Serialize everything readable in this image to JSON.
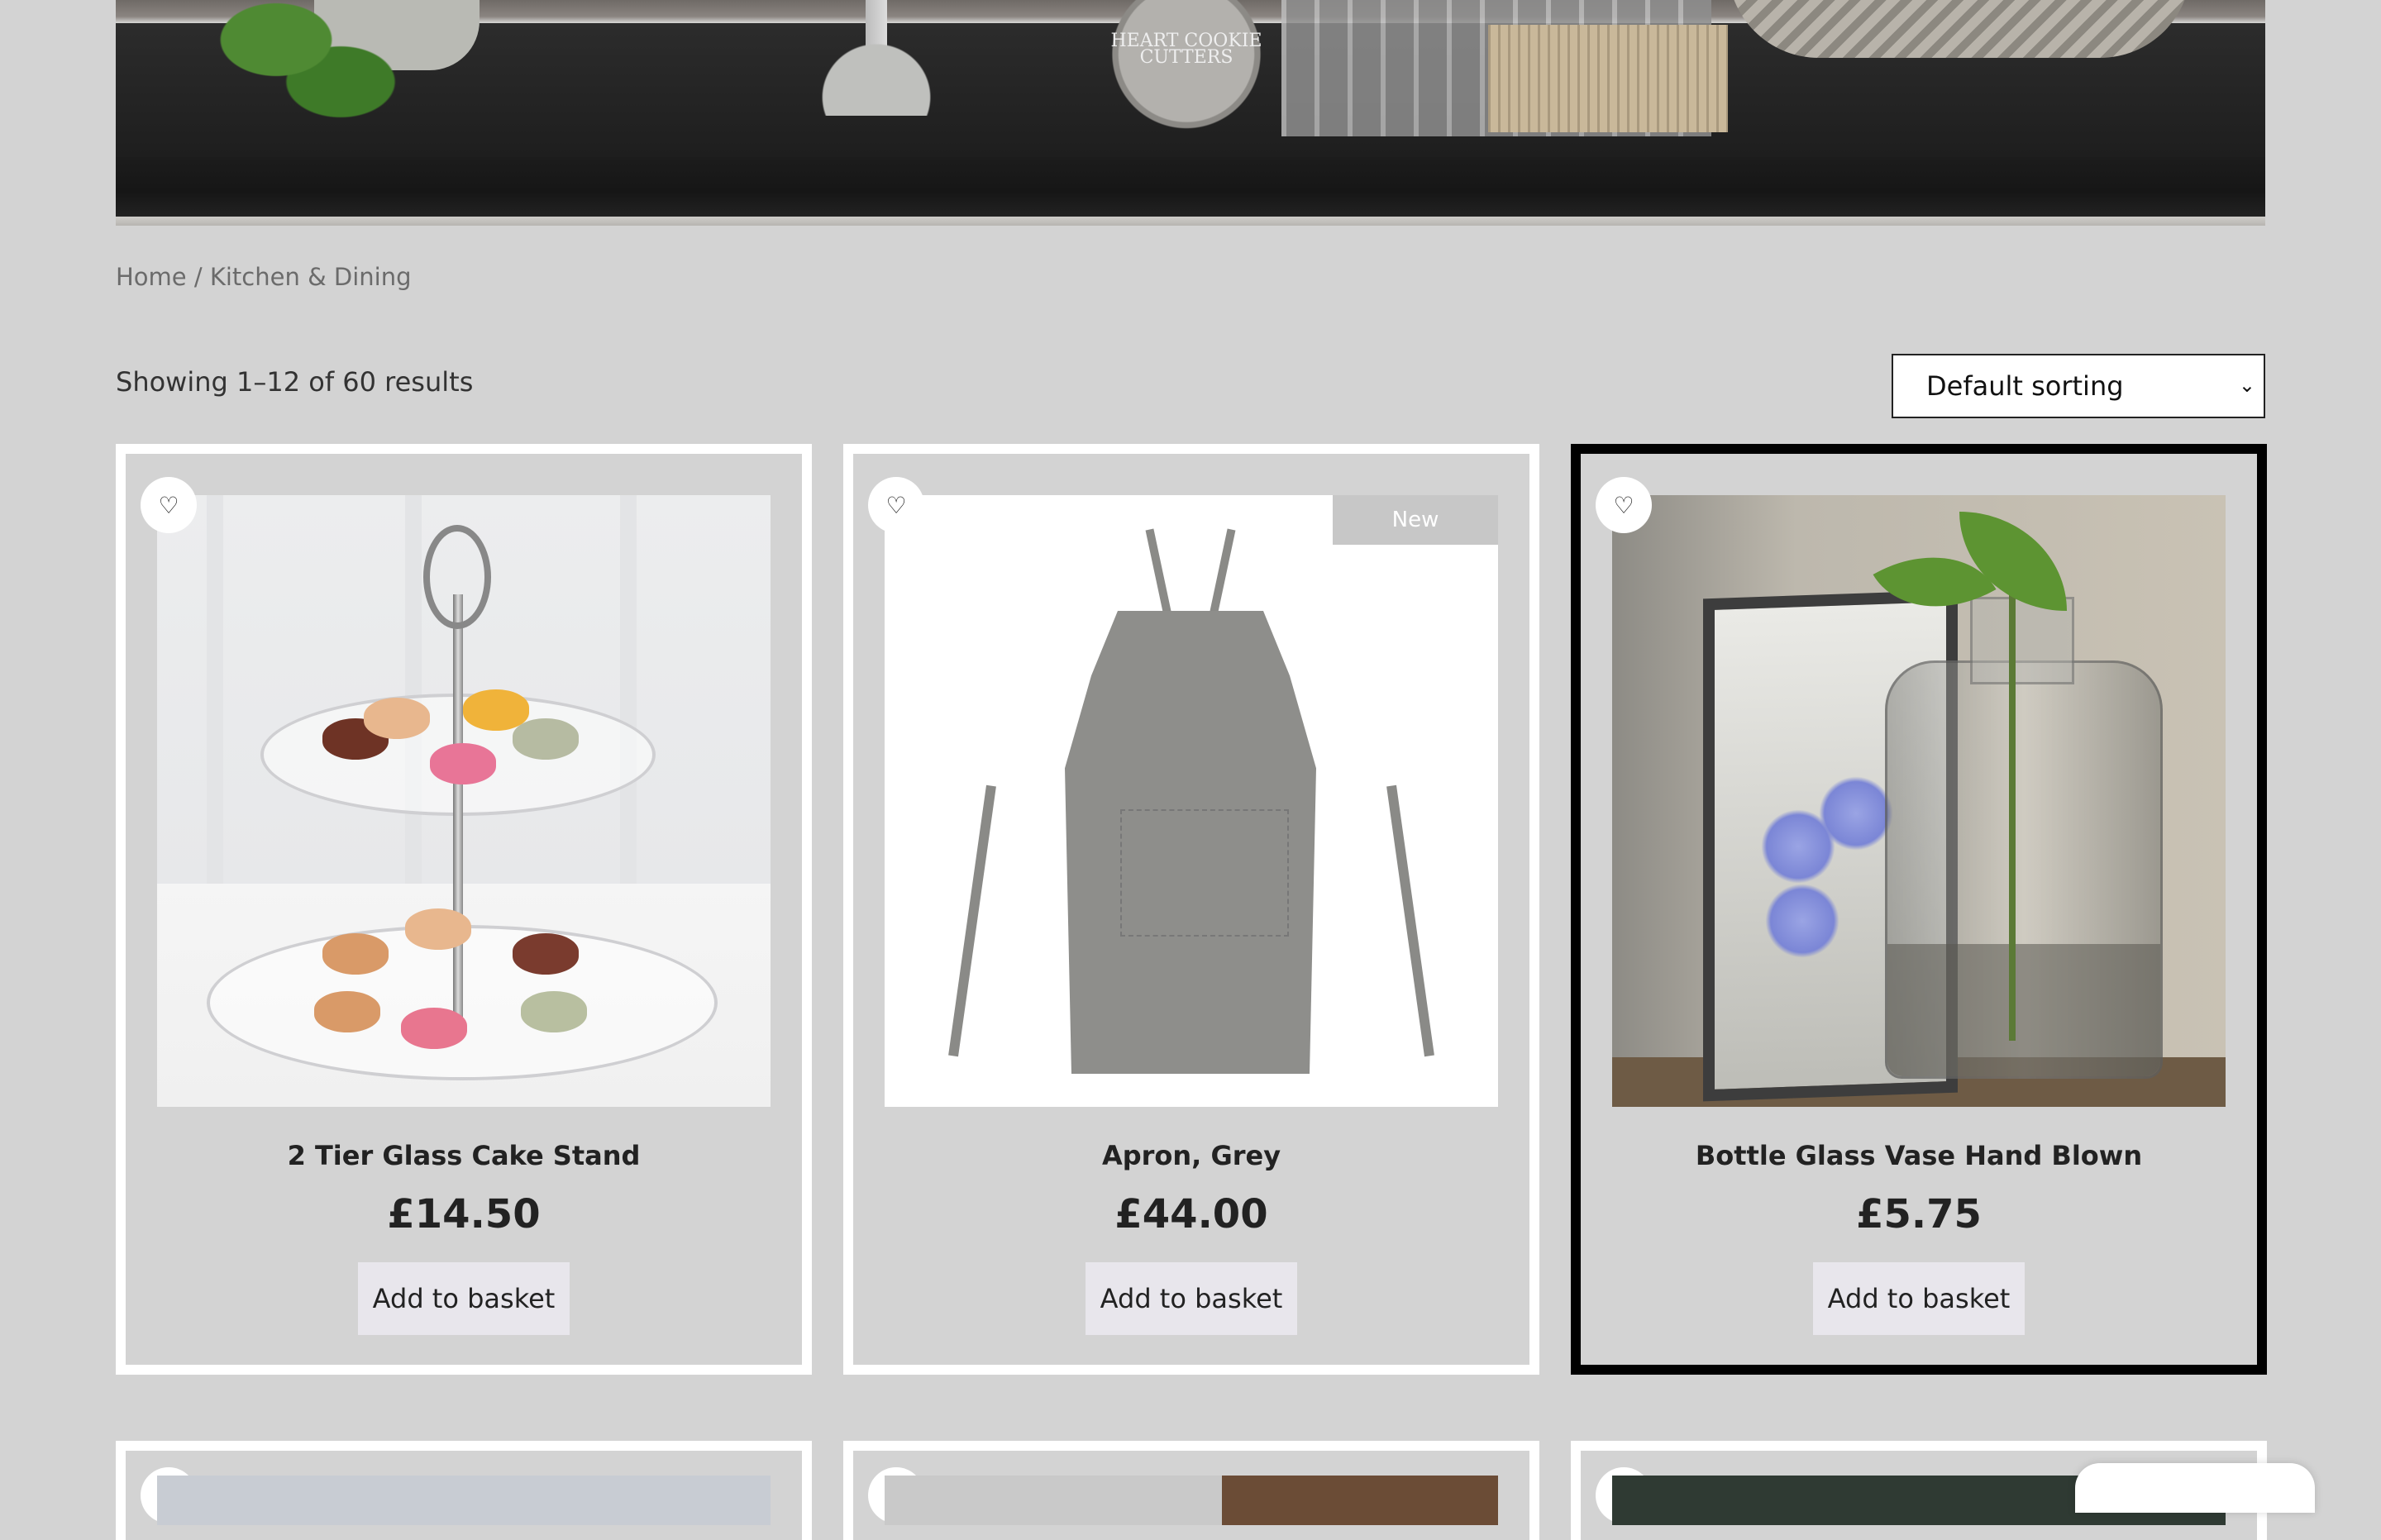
{
  "hero": {
    "tin_text": "HEART COOKIE CUTTERS"
  },
  "breadcrumb": {
    "home": "Home",
    "separator": " / ",
    "current": "Kitchen & Dining"
  },
  "results": {
    "text": "Showing 1–12 of 60 results"
  },
  "sorting": {
    "selected": "Default sorting",
    "icon": "chevron-down-icon"
  },
  "products": [
    {
      "title": "2 Tier Glass Cake Stand",
      "price": "£14.50",
      "button": "Add to basket",
      "badge": ""
    },
    {
      "title": "Apron, Grey",
      "price": "£44.00",
      "button": "Add to basket",
      "badge": "New"
    },
    {
      "title": "Bottle Glass Vase Hand Blown",
      "price": "£5.75",
      "button": "Add to basket",
      "badge": ""
    }
  ],
  "wishlist_icon": "heart-plus-icon",
  "colors": {
    "page_bg": "#d3d3d3",
    "card_border": "#ffffff",
    "active_border": "#000000",
    "button_bg": "#e8e6ec",
    "badge_bg": "#c7c7c7"
  }
}
